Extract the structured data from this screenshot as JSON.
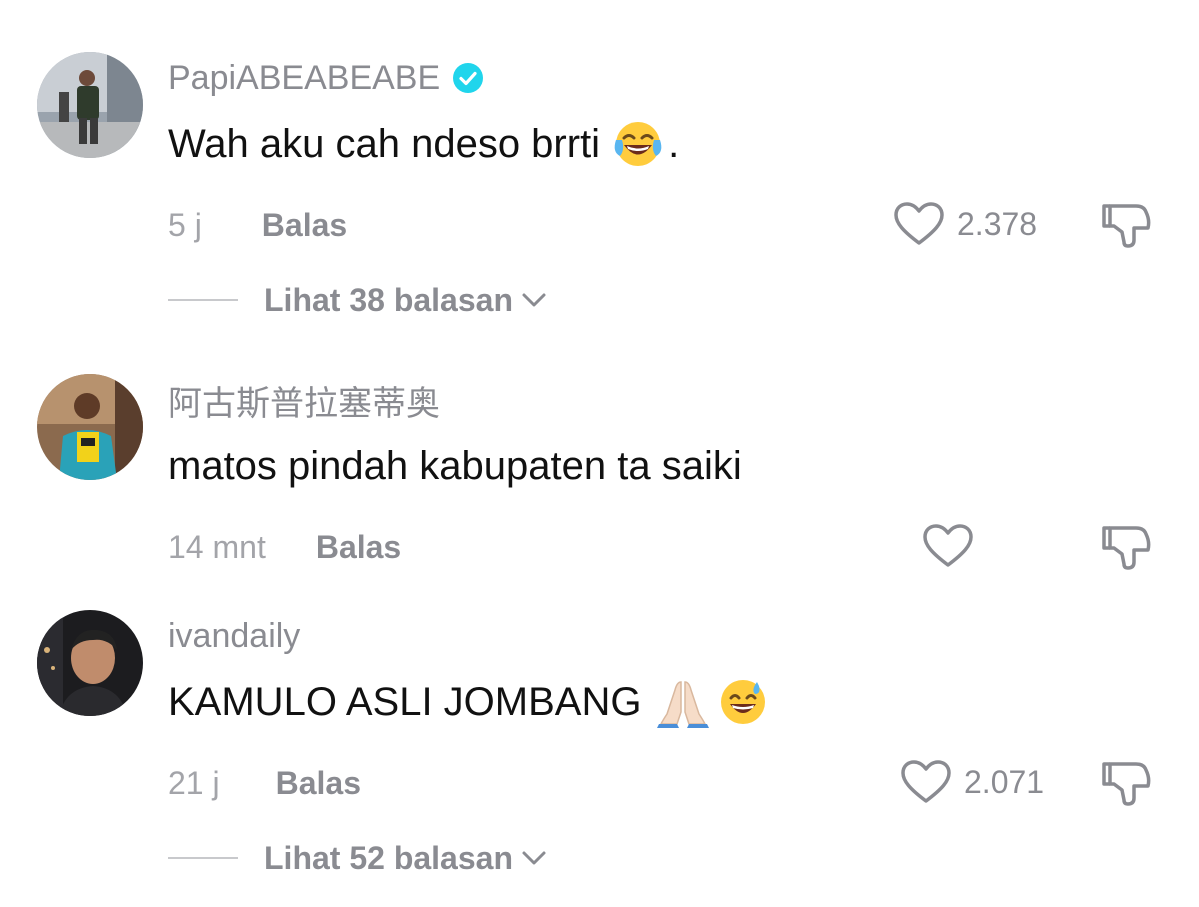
{
  "comments": [
    {
      "username": "PapiABEABEABE",
      "verified": true,
      "text": "Wah aku cah ndeso brrti",
      "text_suffix": ".",
      "emoji": "face-with-tears-of-joy",
      "time": "5 j",
      "reply_label": "Balas",
      "likes": "2.378",
      "view_replies": "Lihat 38 balasan"
    },
    {
      "username": "阿古斯普拉塞蒂奥",
      "verified": false,
      "text": "matos pindah kabupaten ta saiki",
      "time": "14 mnt",
      "reply_label": "Balas",
      "likes": ""
    },
    {
      "username": "ivandaily",
      "verified": false,
      "text": "KAMULO ASLI JOMBANG",
      "emoji": [
        "folded-hands",
        "grinning-face-with-sweat"
      ],
      "time": "21 j",
      "reply_label": "Balas",
      "likes": "2.071",
      "view_replies": "Lihat 52 balasan"
    }
  ],
  "colors": {
    "username": "#8a8b91",
    "text": "#111111",
    "verified": "#20d5ec",
    "muted": "#a3a4a9"
  },
  "icons": [
    "verified-badge-icon",
    "heart-icon",
    "dislike-icon",
    "chevron-down-icon"
  ]
}
